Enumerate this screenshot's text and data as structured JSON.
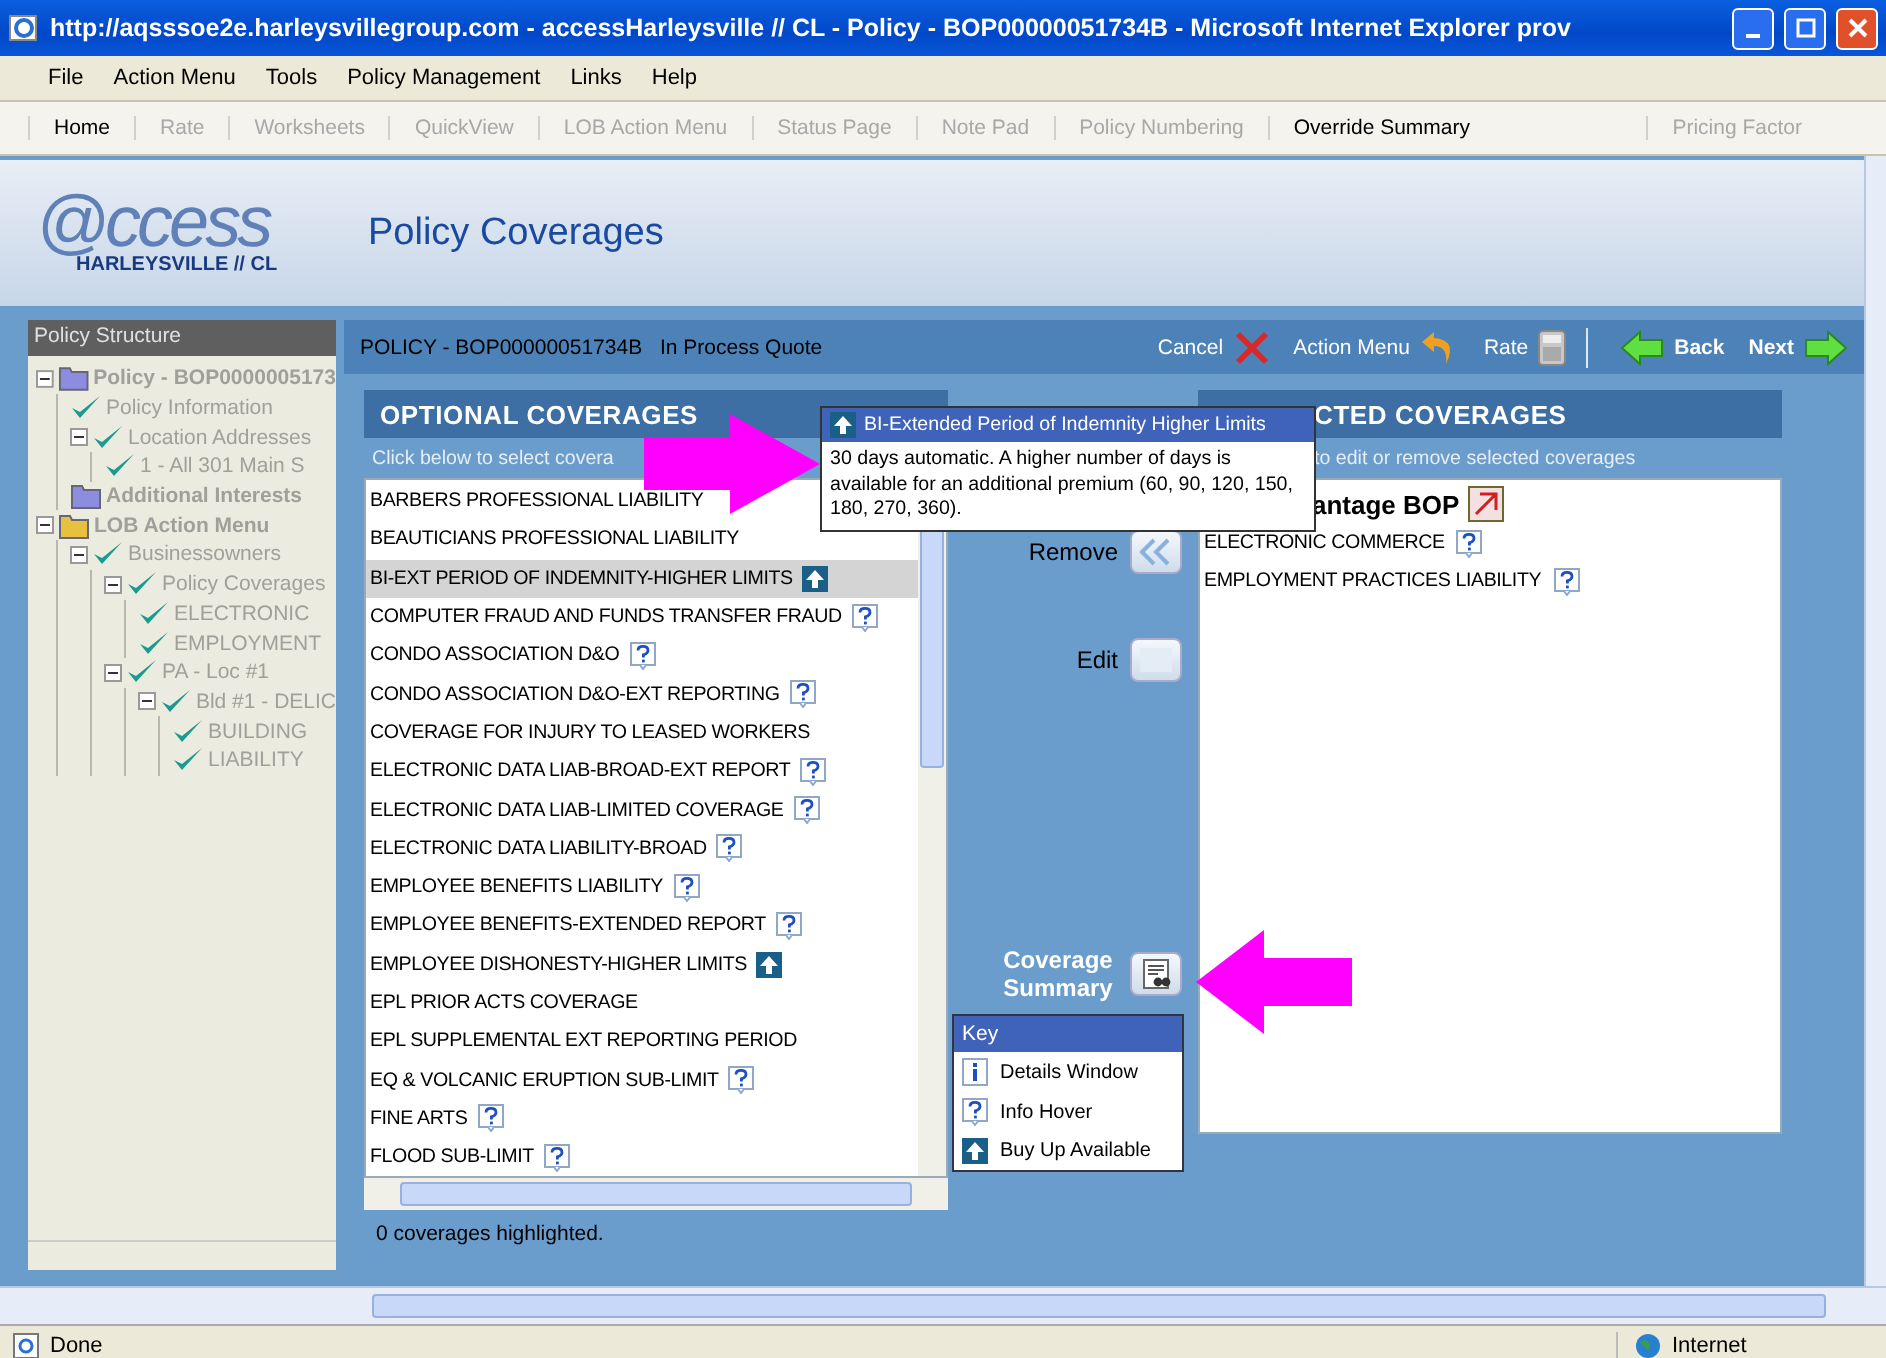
{
  "window": {
    "title": "http://aqsssoe2e.harleysvillegroup.com - accessHarleysville // CL - Policy - BOP00000051734B - Microsoft Internet Explorer prov"
  },
  "menu": [
    "File",
    "Action Menu",
    "Tools",
    "Policy Management",
    "Links",
    "Help"
  ],
  "toolbar": [
    {
      "label": "Home",
      "disabled": false
    },
    {
      "label": "Rate",
      "disabled": true
    },
    {
      "label": "Worksheets",
      "disabled": true
    },
    {
      "label": "QuickView",
      "disabled": true
    },
    {
      "label": "LOB Action Menu",
      "disabled": true
    },
    {
      "label": "Status Page",
      "disabled": true
    },
    {
      "label": "Note Pad",
      "disabled": true
    },
    {
      "label": "Policy Numbering",
      "disabled": true
    },
    {
      "label": "Override Summary",
      "disabled": false
    },
    {
      "label": "Pricing Factor",
      "disabled": true
    }
  ],
  "logo": {
    "brand": "@ccess",
    "subtitle": "HARLEYSVILLE // CL"
  },
  "page_title": "Policy Coverages",
  "sidebar": {
    "title": "Policy Structure",
    "tree": [
      {
        "label": "Policy - BOP0000005173",
        "kind": "folder",
        "color": "#8c8ce0",
        "children": [
          {
            "label": "Policy Information",
            "kind": "check"
          },
          {
            "label": "Location Addresses",
            "kind": "check",
            "children": [
              {
                "label": "1 - All 301 Main S",
                "kind": "check"
              }
            ]
          },
          {
            "label": "Additional Interests",
            "kind": "folder",
            "color": "#8c8ce0"
          }
        ]
      },
      {
        "label": "LOB Action Menu",
        "kind": "folder",
        "color": "#e8c040",
        "children": [
          {
            "label": "Businessowners",
            "kind": "check",
            "children": [
              {
                "label": "Policy Coverages",
                "kind": "check",
                "children": [
                  {
                    "label": "ELECTRONIC",
                    "kind": "check"
                  },
                  {
                    "label": "EMPLOYMENT",
                    "kind": "check"
                  }
                ]
              },
              {
                "label": "PA - Loc #1",
                "kind": "check",
                "children": [
                  {
                    "label": "Bld #1 - DELIC",
                    "kind": "check",
                    "children": [
                      {
                        "label": "BUILDING",
                        "kind": "check"
                      },
                      {
                        "label": "LIABILITY",
                        "kind": "check"
                      }
                    ]
                  }
                ]
              }
            ]
          }
        ]
      }
    ]
  },
  "policy": {
    "number": "POLICY - BOP00000051734B",
    "status": "In Process Quote"
  },
  "actions": [
    {
      "label": "Cancel",
      "kind": "cancel"
    },
    {
      "label": "Action Menu",
      "kind": "undo"
    },
    {
      "label": "Rate",
      "kind": "rate"
    },
    {
      "label": "Back",
      "kind": "back"
    },
    {
      "label": "Next",
      "kind": "next"
    }
  ],
  "optional": {
    "title": "OPTIONAL COVERAGES",
    "hint": "Click below to select covera",
    "footer": "0 coverages highlighted.",
    "items": [
      {
        "name": "BARBERS PROFESSIONAL LIABILITY",
        "kind": "plain",
        "selected": false
      },
      {
        "name": "BEAUTICIANS PROFESSIONAL LIABILITY",
        "kind": "plain",
        "selected": false
      },
      {
        "name": "BI-EXT PERIOD OF INDEMNITY-HIGHER LIMITS",
        "kind": "buy_up",
        "selected": true
      },
      {
        "name": "COMPUTER FRAUD AND FUNDS TRANSFER FRAUD",
        "kind": "info",
        "selected": false
      },
      {
        "name": "CONDO ASSOCIATION D&O",
        "kind": "info",
        "selected": false
      },
      {
        "name": "CONDO ASSOCIATION D&O-EXT REPORTING",
        "kind": "info",
        "selected": false
      },
      {
        "name": "COVERAGE FOR INJURY TO LEASED WORKERS",
        "kind": "plain",
        "selected": false
      },
      {
        "name": "ELECTRONIC DATA LIAB-BROAD-EXT REPORT",
        "kind": "info",
        "selected": false
      },
      {
        "name": "ELECTRONIC DATA LIAB-LIMITED COVERAGE",
        "kind": "info",
        "selected": false
      },
      {
        "name": "ELECTRONIC DATA LIABILITY-BROAD",
        "kind": "info",
        "selected": false
      },
      {
        "name": "EMPLOYEE BENEFITS LIABILITY",
        "kind": "info",
        "selected": false
      },
      {
        "name": "EMPLOYEE BENEFITS-EXTENDED REPORT",
        "kind": "info",
        "selected": false
      },
      {
        "name": "EMPLOYEE DISHONESTY-HIGHER LIMITS",
        "kind": "buy_up",
        "selected": false
      },
      {
        "name": "EPL PRIOR ACTS COVERAGE",
        "kind": "plain",
        "selected": false
      },
      {
        "name": "EPL SUPPLEMENTAL EXT REPORTING PERIOD",
        "kind": "plain",
        "selected": false
      },
      {
        "name": "EQ & VOLCANIC ERUPTION SUB-LIMIT",
        "kind": "info",
        "selected": false
      },
      {
        "name": "FINE ARTS",
        "kind": "info",
        "selected": false
      },
      {
        "name": "FLOOD SUB-LIMIT",
        "kind": "info",
        "selected": false
      }
    ]
  },
  "middle": [
    {
      "label": "Remove",
      "kind": "remove"
    },
    {
      "label": "Edit",
      "kind": "edit"
    },
    {
      "label": "Coverage Summary",
      "kind": "summary"
    }
  ],
  "key": {
    "title": "Key",
    "items": [
      {
        "label": "Details Window",
        "kind": "details"
      },
      {
        "label": "Info Hover",
        "kind": "info"
      },
      {
        "label": "Buy Up Available",
        "kind": "buy_up"
      }
    ]
  },
  "selected": {
    "title": "CTED COVERAGES",
    "hint": "to edit or remove selected coverages",
    "group": "antage BOP",
    "items": [
      {
        "name": "ELECTRONIC COMMERCE",
        "kind": "info"
      },
      {
        "name": "EMPLOYMENT PRACTICES LIABILITY",
        "kind": "info"
      }
    ]
  },
  "tooltip": {
    "title": "BI-Extended Period of Indemnity Higher Limits",
    "body": "30 days automatic. A higher number of days is available for an additional premium (60, 90, 120, 150, 180, 270, 360)."
  },
  "status_bar": {
    "text": "Done",
    "zone": "Internet"
  }
}
